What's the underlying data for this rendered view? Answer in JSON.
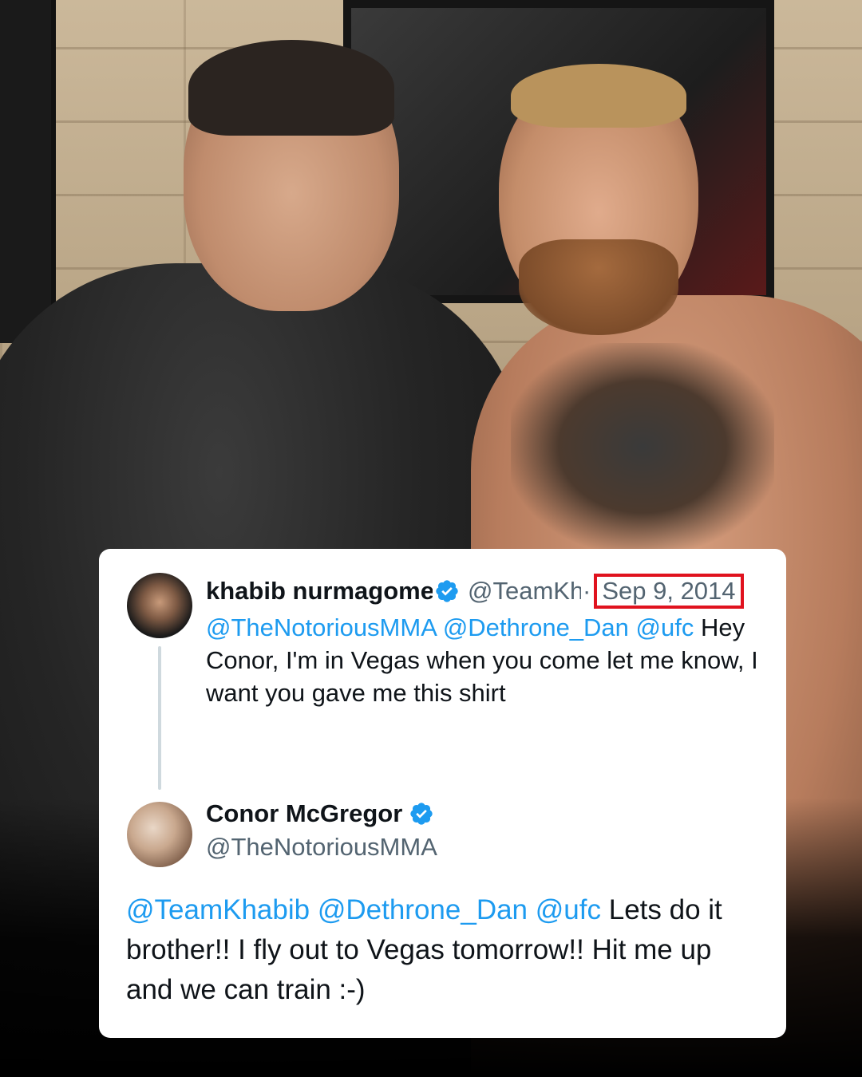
{
  "tweet_reply": {
    "author": {
      "name": "khabib nurmagome",
      "handle": "@TeamKh",
      "separator": "·",
      "date": "Sep 9, 2014",
      "verified": true,
      "avatar_icon": "avatar-khabib-icon"
    },
    "text": [
      {
        "kind": "mention",
        "value": "@TheNotoriousMMA"
      },
      {
        "kind": "text",
        "value": " "
      },
      {
        "kind": "mention",
        "value": "@Dethrone_Dan"
      },
      {
        "kind": "text",
        "value": " "
      },
      {
        "kind": "mention",
        "value": "@ufc"
      },
      {
        "kind": "text",
        "value": " Hey Conor, I'm in Vegas when you come let me know, I want you gave me this shirt"
      }
    ]
  },
  "tweet_main": {
    "author": {
      "name": "Conor McGregor",
      "handle": "@TheNotoriousMMA",
      "verified": true,
      "avatar_icon": "avatar-conor-icon"
    },
    "text": [
      {
        "kind": "mention",
        "value": "@TeamKhabib"
      },
      {
        "kind": "text",
        "value": " "
      },
      {
        "kind": "mention",
        "value": "@Dethrone_Dan"
      },
      {
        "kind": "text",
        "value": " "
      },
      {
        "kind": "mention",
        "value": "@ufc"
      },
      {
        "kind": "text",
        "value": " Lets do it brother!! I fly out to Vegas tomorrow!! Hit me up and we can train :-)"
      }
    ]
  },
  "colors": {
    "mention": "#1d9bf0",
    "text": "#0f1419",
    "secondary": "#536471",
    "highlight_box": "#e0121e",
    "verified": "#1d9bf0"
  }
}
